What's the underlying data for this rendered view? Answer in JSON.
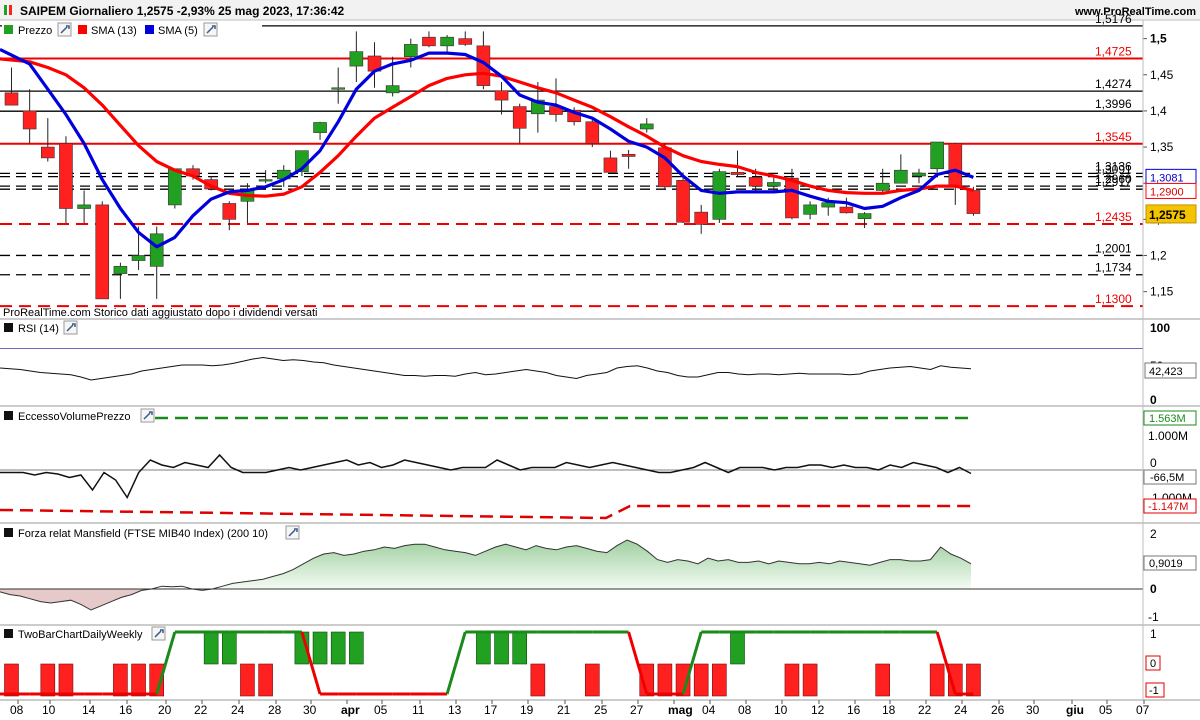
{
  "header": {
    "title": "SAIPEM Giornaliero 1,2575 -2,93% 25 mag 2023, 17:36:42",
    "site": "www.ProRealTime.com"
  },
  "legend": {
    "price": "Prezzo",
    "sma13": "SMA (13)",
    "sma5": "SMA (5)"
  },
  "note": "ProRealTime.com Storico dati aggiustato dopo i dividendi versati",
  "panels": {
    "rsi": {
      "label": "RSI (14)",
      "value_box": "42,423",
      "ticks": [
        "100",
        "50",
        "0"
      ]
    },
    "volume": {
      "label": "EccessoVolumePrezzo",
      "ticks": [
        "1.000M",
        "0",
        "-1.000M"
      ],
      "top_box": "1.563M",
      "value_box": "-66,5M",
      "bottom_box": "-1.147M"
    },
    "mansfield": {
      "label": "Forza relat Mansfield (FTSE MIB40 Index) (200 10)",
      "ticks": [
        "2",
        "1",
        "0",
        "-1"
      ],
      "value_box": "0,9019"
    },
    "twobar": {
      "label": "TwoBarChartDailyWeekly",
      "ticks": [
        "1",
        "0",
        "-1"
      ]
    }
  },
  "colors": {
    "up": "#22a022",
    "down": "#ff2020",
    "sma13": "#ff0000",
    "sma5": "#0000dd",
    "last_price_box": "#f5c400",
    "sma5_box_text": "#0000cc",
    "sma13_box_text": "#dd0000",
    "green_dash": "#1a8a1a",
    "red_dash": "#e00000",
    "mansfield_fill": "#c9e6c9",
    "mansfield_neg_fill": "#e6c9c9"
  },
  "icons": [
    "wrench-icon",
    "color-swatch-icon"
  ],
  "chart_data": {
    "type": "candlestick",
    "title": "SAIPEM Giornaliero",
    "x_tick_labels": [
      "08",
      "10",
      "14",
      "16",
      "20",
      "22",
      "24",
      "28",
      "30",
      "apr",
      "05",
      "11",
      "13",
      "17",
      "19",
      "21",
      "25",
      "27",
      "mag",
      "04",
      "08",
      "10",
      "12",
      "16",
      "18",
      "22",
      "24",
      "26",
      "30",
      "giu",
      "05",
      "07"
    ],
    "y_tick_labels": [
      "1,5",
      "1,45",
      "1,4",
      "1,35",
      "1,3",
      "1,25",
      "1,2",
      "1,15"
    ],
    "ylim": [
      1.126,
      1.523
    ],
    "last_price": "1,2575",
    "sma5_last": "1,3081",
    "sma13_last": "1,2900",
    "levels": [
      {
        "value": 1.5176,
        "label": "1,5176",
        "style": "solid",
        "color": "#000000"
      },
      {
        "value": 1.4725,
        "label": "1,4725",
        "style": "solid",
        "color": "#ee0000"
      },
      {
        "value": 1.4274,
        "label": "1,4274",
        "style": "solid",
        "color": "#000000"
      },
      {
        "value": 1.3996,
        "label": "1,3996",
        "style": "solid",
        "color": "#000000"
      },
      {
        "value": 1.3545,
        "label": "1,3545",
        "style": "solid",
        "color": "#ee0000"
      },
      {
        "value": 1.3136,
        "label": "1,3136",
        "style": "dashed",
        "color": "#000000"
      },
      {
        "value": 1.3091,
        "label": "1,3091",
        "style": "dashed",
        "color": "#000000"
      },
      {
        "value": 1.296,
        "label": "1,2960",
        "style": "dashed",
        "color": "#000000"
      },
      {
        "value": 1.2917,
        "label": "1,2917",
        "style": "dashed",
        "color": "#000000"
      },
      {
        "value": 1.2435,
        "label": "1,2435",
        "style": "dashed",
        "color": "#ee0000"
      },
      {
        "value": 1.2001,
        "label": "1,2001",
        "style": "dashed",
        "color": "#000000"
      },
      {
        "value": 1.1734,
        "label": "1,1734",
        "style": "dashed",
        "color": "#000000"
      },
      {
        "value": 1.13,
        "label": "1,1300",
        "style": "dashed",
        "color": "#ee0000"
      }
    ],
    "candles": [
      {
        "o": 1.425,
        "h": 1.46,
        "l": 1.41,
        "c": 1.408
      },
      {
        "o": 1.4,
        "h": 1.43,
        "l": 1.355,
        "c": 1.375
      },
      {
        "o": 1.35,
        "h": 1.39,
        "l": 1.33,
        "c": 1.335
      },
      {
        "o": 1.355,
        "h": 1.365,
        "l": 1.245,
        "c": 1.265
      },
      {
        "o": 1.265,
        "h": 1.29,
        "l": 1.245,
        "c": 1.27
      },
      {
        "o": 1.27,
        "h": 1.275,
        "l": 1.14,
        "c": 1.14
      },
      {
        "o": 1.175,
        "h": 1.19,
        "l": 1.14,
        "c": 1.185
      },
      {
        "o": 1.193,
        "h": 1.24,
        "l": 1.18,
        "c": 1.2
      },
      {
        "o": 1.185,
        "h": 1.24,
        "l": 1.14,
        "c": 1.23
      },
      {
        "o": 1.27,
        "h": 1.32,
        "l": 1.265,
        "c": 1.32
      },
      {
        "o": 1.32,
        "h": 1.325,
        "l": 1.305,
        "c": 1.31
      },
      {
        "o": 1.305,
        "h": 1.31,
        "l": 1.29,
        "c": 1.292
      },
      {
        "o": 1.272,
        "h": 1.275,
        "l": 1.235,
        "c": 1.25
      },
      {
        "o": 1.275,
        "h": 1.3,
        "l": 1.245,
        "c": 1.29
      },
      {
        "o": 1.305,
        "h": 1.318,
        "l": 1.3,
        "c": 1.305
      },
      {
        "o": 1.306,
        "h": 1.325,
        "l": 1.295,
        "c": 1.318
      },
      {
        "o": 1.316,
        "h": 1.345,
        "l": 1.31,
        "c": 1.345
      },
      {
        "o": 1.37,
        "h": 1.385,
        "l": 1.36,
        "c": 1.384
      },
      {
        "o": 1.43,
        "h": 1.46,
        "l": 1.41,
        "c": 1.432
      },
      {
        "o": 1.462,
        "h": 1.51,
        "l": 1.44,
        "c": 1.482
      },
      {
        "o": 1.476,
        "h": 1.495,
        "l": 1.432,
        "c": 1.455
      },
      {
        "o": 1.425,
        "h": 1.475,
        "l": 1.42,
        "c": 1.435
      },
      {
        "o": 1.475,
        "h": 1.5,
        "l": 1.46,
        "c": 1.492
      },
      {
        "o": 1.502,
        "h": 1.51,
        "l": 1.488,
        "c": 1.49
      },
      {
        "o": 1.49,
        "h": 1.505,
        "l": 1.48,
        "c": 1.502
      },
      {
        "o": 1.5,
        "h": 1.51,
        "l": 1.49,
        "c": 1.492
      },
      {
        "o": 1.49,
        "h": 1.51,
        "l": 1.43,
        "c": 1.435
      },
      {
        "o": 1.428,
        "h": 1.44,
        "l": 1.395,
        "c": 1.415
      },
      {
        "o": 1.406,
        "h": 1.41,
        "l": 1.355,
        "c": 1.376
      },
      {
        "o": 1.396,
        "h": 1.44,
        "l": 1.37,
        "c": 1.415
      },
      {
        "o": 1.406,
        "h": 1.445,
        "l": 1.385,
        "c": 1.395
      },
      {
        "o": 1.401,
        "h": 1.405,
        "l": 1.38,
        "c": 1.385
      },
      {
        "o": 1.385,
        "h": 1.39,
        "l": 1.35,
        "c": 1.355
      },
      {
        "o": 1.335,
        "h": 1.345,
        "l": 1.315,
        "c": 1.315
      },
      {
        "o": 1.34,
        "h": 1.346,
        "l": 1.32,
        "c": 1.337
      },
      {
        "o": 1.375,
        "h": 1.39,
        "l": 1.37,
        "c": 1.382
      },
      {
        "o": 1.349,
        "h": 1.355,
        "l": 1.292,
        "c": 1.295
      },
      {
        "o": 1.304,
        "h": 1.315,
        "l": 1.245,
        "c": 1.246
      },
      {
        "o": 1.26,
        "h": 1.27,
        "l": 1.23,
        "c": 1.243
      },
      {
        "o": 1.25,
        "h": 1.32,
        "l": 1.245,
        "c": 1.316
      },
      {
        "o": 1.315,
        "h": 1.345,
        "l": 1.308,
        "c": 1.312
      },
      {
        "o": 1.308,
        "h": 1.32,
        "l": 1.29,
        "c": 1.296
      },
      {
        "o": 1.296,
        "h": 1.312,
        "l": 1.288,
        "c": 1.301
      },
      {
        "o": 1.307,
        "h": 1.32,
        "l": 1.25,
        "c": 1.252
      },
      {
        "o": 1.257,
        "h": 1.275,
        "l": 1.25,
        "c": 1.27
      },
      {
        "o": 1.267,
        "h": 1.28,
        "l": 1.255,
        "c": 1.273
      },
      {
        "o": 1.267,
        "h": 1.28,
        "l": 1.258,
        "c": 1.259
      },
      {
        "o": 1.251,
        "h": 1.26,
        "l": 1.238,
        "c": 1.258
      },
      {
        "o": 1.29,
        "h": 1.32,
        "l": 1.285,
        "c": 1.3
      },
      {
        "o": 1.3,
        "h": 1.34,
        "l": 1.3,
        "c": 1.318
      },
      {
        "o": 1.31,
        "h": 1.32,
        "l": 1.3,
        "c": 1.314
      },
      {
        "o": 1.32,
        "h": 1.357,
        "l": 1.315,
        "c": 1.357
      },
      {
        "o": 1.355,
        "h": 1.356,
        "l": 1.27,
        "c": 1.295
      },
      {
        "o": 1.29,
        "h": 1.295,
        "l": 1.255,
        "c": 1.258
      }
    ],
    "sma5": [
      1.485,
      1.465,
      1.43,
      1.395,
      1.355,
      1.305,
      1.265,
      1.232,
      1.212,
      1.225,
      1.255,
      1.278,
      1.288,
      1.29,
      1.295,
      1.305,
      1.32,
      1.345,
      1.385,
      1.43,
      1.455,
      1.465,
      1.47,
      1.48,
      1.48,
      1.478,
      1.467,
      1.448,
      1.422,
      1.412,
      1.408,
      1.398,
      1.39,
      1.375,
      1.358,
      1.35,
      1.335,
      1.31,
      1.29,
      1.286,
      1.288,
      1.288,
      1.288,
      1.29,
      1.282,
      1.275,
      1.273,
      1.265,
      1.268,
      1.28,
      1.29,
      1.312,
      1.318,
      1.308
    ],
    "sma13": [
      1.472,
      1.468,
      1.46,
      1.45,
      1.432,
      1.408,
      1.38,
      1.352,
      1.33,
      1.318,
      1.31,
      1.296,
      1.286,
      1.283,
      1.282,
      1.285,
      1.295,
      1.315,
      1.338,
      1.365,
      1.39,
      1.405,
      1.42,
      1.435,
      1.445,
      1.45,
      1.452,
      1.448,
      1.44,
      1.432,
      1.425,
      1.415,
      1.405,
      1.392,
      1.378,
      1.365,
      1.35,
      1.338,
      1.33,
      1.326,
      1.323,
      1.315,
      1.31,
      1.304,
      1.296,
      1.29,
      1.287,
      1.286,
      1.286,
      1.29,
      1.292,
      1.296,
      1.296,
      1.29
    ],
    "rsi": [
      44,
      43,
      42,
      40,
      38,
      37,
      36,
      35,
      32,
      28,
      30,
      32,
      34,
      36,
      40,
      42,
      44,
      46,
      48,
      48,
      48,
      47,
      48,
      50,
      53,
      56,
      58,
      56,
      54,
      55,
      54,
      52,
      51,
      48,
      46,
      44,
      42,
      40,
      38,
      36,
      34,
      34,
      33,
      34,
      34,
      33,
      36,
      38,
      35,
      36,
      38,
      40,
      42,
      40,
      38,
      34,
      32,
      30,
      34,
      36,
      38,
      44,
      46,
      47,
      44,
      40,
      38,
      34,
      32,
      32,
      35,
      38,
      38,
      36,
      35,
      36,
      36,
      35,
      36,
      37,
      36,
      36,
      36,
      36,
      35,
      36,
      40,
      42,
      44,
      45,
      46,
      44,
      42,
      47,
      45,
      44,
      43
    ],
    "volume_excess": [
      -0.05,
      -0.05,
      -0.05,
      -0.1,
      -0.05,
      -0.08,
      -0.15,
      -0.1,
      -0.4,
      -0.05,
      -0.2,
      -0.55,
      -0.05,
      0.2,
      0.1,
      0.05,
      0.15,
      0.1,
      0.05,
      0.3,
      0.05,
      -0.05,
      -0.05,
      -0.05,
      0.0,
      0.05,
      0.0,
      0.05,
      0.1,
      0.15,
      0.2,
      0.1,
      0.15,
      0.05,
      0.1,
      0.2,
      0.15,
      0.1,
      0.05,
      0.0,
      0.05,
      0.05,
      0.05,
      0.2,
      0.1,
      0.0,
      0.05,
      0.05,
      0.05,
      0.15,
      0.1,
      0.05,
      0.1,
      0.15,
      0.1,
      0.05,
      0.0,
      -0.05,
      -0.05,
      0.0,
      0.05,
      0.15,
      0.05,
      -0.05,
      0.05,
      0.05,
      0.05,
      0.0,
      0.05,
      0.05,
      0.1,
      0.1,
      0.05,
      0.1,
      0.05,
      0.05,
      0.0,
      0.1,
      0.05,
      0.15,
      0.1,
      0.05,
      -0.05,
      0.05,
      -0.07
    ],
    "volume_upper": 1.563,
    "volume_lower": -1.147,
    "mansfield": [
      -0.1,
      -0.2,
      -0.25,
      -0.35,
      -0.45,
      -0.5,
      -0.45,
      -0.4,
      -0.55,
      -0.75,
      -0.6,
      -0.45,
      -0.3,
      -0.2,
      -0.05,
      0.0,
      0.1,
      0.08,
      0.1,
      0.0,
      -0.05,
      0.0,
      0.1,
      0.2,
      0.25,
      0.3,
      0.35,
      0.45,
      0.55,
      0.7,
      0.9,
      1.1,
      1.25,
      1.3,
      1.2,
      1.25,
      1.35,
      1.4,
      1.5,
      1.45,
      1.55,
      1.6,
      1.6,
      1.5,
      1.4,
      1.35,
      1.3,
      1.2,
      1.35,
      1.5,
      1.6,
      1.5,
      1.4,
      1.55,
      1.45,
      1.4,
      1.5,
      1.55,
      1.45,
      1.35,
      1.3,
      1.55,
      1.75,
      1.6,
      1.35,
      1.05,
      0.95,
      1.05,
      1.0,
      0.9,
      1.1,
      1.0,
      1.05,
      0.95,
      0.95,
      1.0,
      0.9,
      1.0,
      0.95,
      0.9,
      0.9,
      0.95,
      0.9,
      1.0,
      0.95,
      0.9,
      0.85,
      0.95,
      1.05,
      1.05,
      1.0,
      1.0,
      1.05,
      1.5,
      1.25,
      1.1,
      0.9
    ],
    "twobar_bars": [
      -1,
      -1,
      -1,
      -1,
      -1,
      -1,
      1,
      1,
      -1,
      -1,
      1,
      1,
      1,
      1,
      1,
      1,
      1,
      -1,
      -1,
      -1,
      -1,
      -1,
      -1,
      -1,
      1,
      -1,
      -1,
      -1,
      -1,
      -1,
      -1,
      -1,
      -1,
      1,
      1,
      -1,
      -1,
      -1,
      1,
      -1,
      -1
    ],
    "twobar_line": [
      -1,
      -1,
      -1,
      -1,
      -1,
      -1,
      -1,
      -1,
      -1,
      1,
      1,
      1,
      1,
      1,
      1,
      1,
      1,
      -1,
      -1,
      -1,
      -1,
      -1,
      -1,
      -1,
      -1,
      1,
      1,
      1,
      1,
      1,
      1,
      1,
      1,
      1,
      1,
      -1,
      -1,
      -1,
      1,
      1,
      1,
      1,
      1,
      1,
      1,
      1,
      1,
      1,
      1,
      1,
      1,
      1,
      -1,
      -1
    ]
  }
}
